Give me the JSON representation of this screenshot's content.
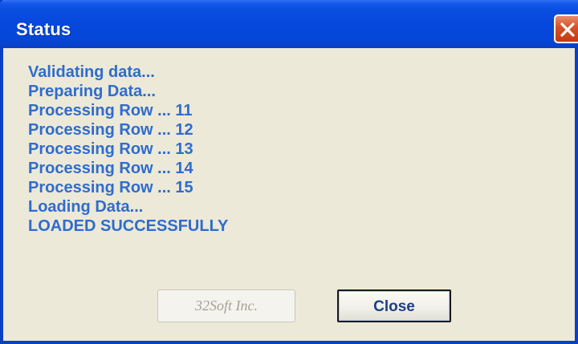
{
  "window": {
    "title": "Status"
  },
  "log": {
    "lines": [
      "Validating data...",
      "Preparing Data...",
      "Processing Row ... 11",
      "Processing Row ... 12",
      "Processing Row ... 13",
      "Processing Row ... 14",
      "Processing Row ... 15",
      "Loading Data...",
      "LOADED SUCCESSFULLY"
    ]
  },
  "buttons": {
    "brand_label": "32Soft Inc.",
    "close_label": "Close"
  },
  "icons": {
    "close": "close-icon"
  },
  "colors": {
    "titlebar": "#0a4fe0",
    "window_bg": "#ece9d8",
    "log_text": "#2f6ccd",
    "close_button": "#d6502a"
  }
}
